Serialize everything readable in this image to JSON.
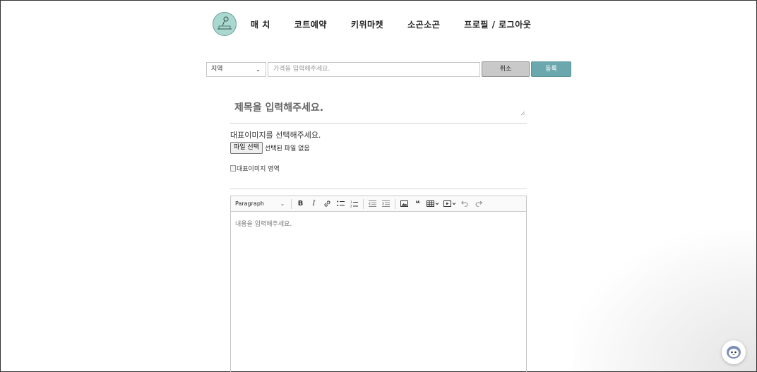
{
  "nav": {
    "items": [
      {
        "label": "매 치"
      },
      {
        "label": "코트예약"
      },
      {
        "label": "키위마켓"
      },
      {
        "label": "소곤소곤"
      },
      {
        "label": "프로필 / 로그아웃"
      }
    ]
  },
  "form": {
    "region_value": "지역",
    "price_placeholder": "가격을 입력해주세요.",
    "cancel_label": "취소",
    "submit_label": "등록"
  },
  "post": {
    "title_placeholder": "제목을 입력해주세요.",
    "image_label": "대표이미지를 선택해주세요.",
    "file_button": "파일 선택",
    "file_status": "선택된 파일 없음",
    "image_alt": "대표이미지 영역"
  },
  "editor": {
    "paragraph_label": "Paragraph",
    "content_placeholder": "내용을 입력해주세요."
  },
  "colors": {
    "accent": "#6aa8ae",
    "cancel_bg": "#c9c9c9",
    "logo_bg": "#a8d8cf"
  }
}
